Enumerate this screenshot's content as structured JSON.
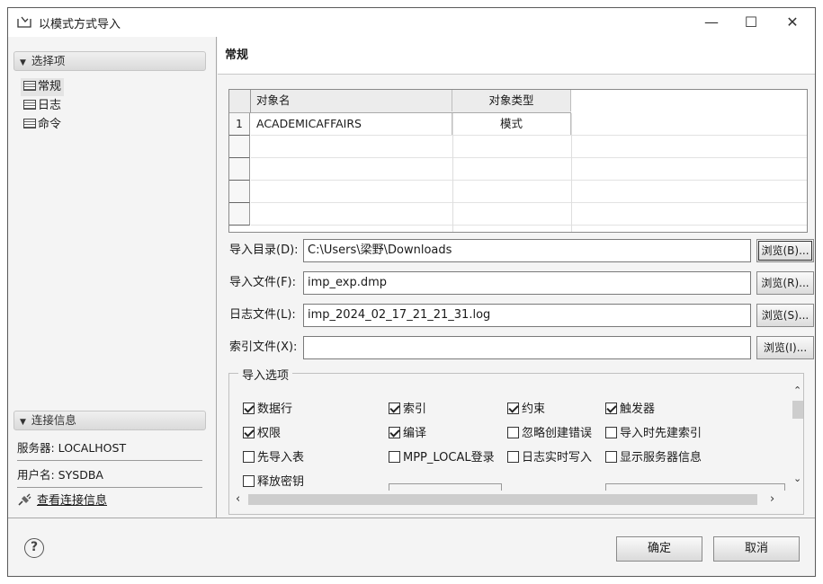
{
  "window": {
    "title": "以模式方式导入",
    "minimize": "—",
    "maximize": "☐",
    "close": "✕"
  },
  "left": {
    "section1": "选择项",
    "nav": [
      {
        "label": "常规"
      },
      {
        "label": "日志"
      },
      {
        "label": "命令"
      }
    ],
    "section2": "连接信息",
    "server": "服务器: LOCALHOST",
    "user": "用户名: SYSDBA",
    "view_link": "查看连接信息"
  },
  "main": {
    "title": "常规",
    "table": {
      "columns": [
        "对象名",
        "对象类型"
      ],
      "rows": [
        {
          "num": "1",
          "name": "ACADEMICAFFAIRS",
          "type": "模式"
        }
      ]
    },
    "fields": [
      {
        "label": "导入目录(D):",
        "value": "C:\\Users\\梁野\\Downloads",
        "browse": "浏览(B)..."
      },
      {
        "label": "导入文件(F):",
        "value": "imp_exp.dmp",
        "browse": "浏览(R)..."
      },
      {
        "label": "日志文件(L):",
        "value": "imp_2024_02_17_21_21_31.log",
        "browse": "浏览(S)..."
      },
      {
        "label": "索引文件(X):",
        "value": "",
        "browse": "浏览(I)..."
      }
    ],
    "options_title": "导入选项",
    "options": [
      {
        "label": "数据行",
        "checked": true
      },
      {
        "label": "索引",
        "checked": true
      },
      {
        "label": "约束",
        "checked": true
      },
      {
        "label": "触发器",
        "checked": true
      },
      {
        "label": "权限",
        "checked": true
      },
      {
        "label": "编译",
        "checked": true
      },
      {
        "label": "忽略创建错误",
        "checked": false
      },
      {
        "label": "导入时先建索引",
        "checked": false
      },
      {
        "label": "先导入表",
        "checked": false
      },
      {
        "label": "MPP_LOCAL登录",
        "checked": false
      },
      {
        "label": "日志实时写入",
        "checked": false
      },
      {
        "label": "显示服务器信息",
        "checked": false
      },
      {
        "label": "释放密钥",
        "checked": false
      }
    ]
  },
  "footer": {
    "help": "?",
    "ok": "确定",
    "cancel": "取消"
  }
}
